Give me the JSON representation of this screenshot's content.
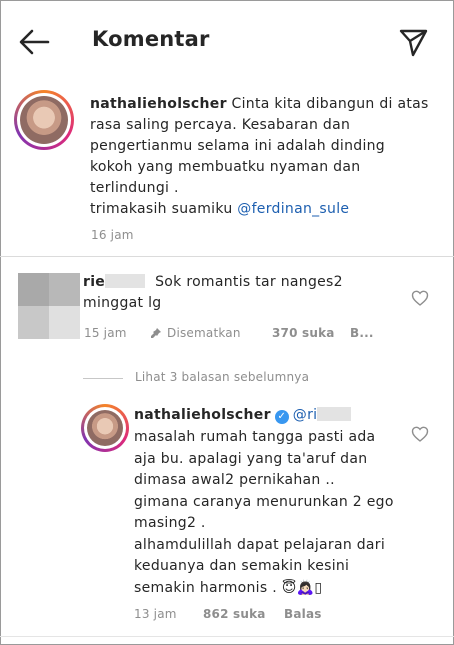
{
  "header": {
    "title": "Komentar"
  },
  "post": {
    "username": "nathalieholscher",
    "text_lines": [
      " Cinta kita dibangun di atas",
      "rasa saling percaya. Kesabaran dan",
      "pengertianmu selama ini adalah dinding",
      "kokoh yang membuatku nyaman dan",
      "terlindungi .",
      "trimakasih suamiku "
    ],
    "mention": "@ferdinan_sule",
    "time": "16 jam"
  },
  "comment1": {
    "username": "rie",
    "text_line1": "Sok romantis tar nanges2",
    "text_line2": "minggat lg",
    "time": "15 jam",
    "pinned_label": "Disematkan",
    "likes": "370 suka",
    "reply_short": "B..."
  },
  "view_replies": "Lihat 3 balasan sebelumnya",
  "reply1": {
    "username": "nathalieholscher",
    "mention": "@ri",
    "text_lines": [
      "masalah rumah tangga pasti ada",
      "aja bu. apalagi yang ta'aruf dan",
      "dimasa awal2 pernikahan ..",
      "gimana caranya menurunkan 2 ego",
      "masing2 .",
      "alhamdulillah dapat pelajaran dari",
      "keduanya dan semakin kesini",
      "semakin harmonis . 😇🙇🏻‍♀️▯"
    ],
    "time": "13 jam",
    "likes": "862 suka",
    "reply_label": "Balas"
  },
  "colors": {
    "text": "#262626",
    "meta": "#8e8e8e",
    "mention": "#1d5fb0",
    "verified": "#3897f0"
  }
}
